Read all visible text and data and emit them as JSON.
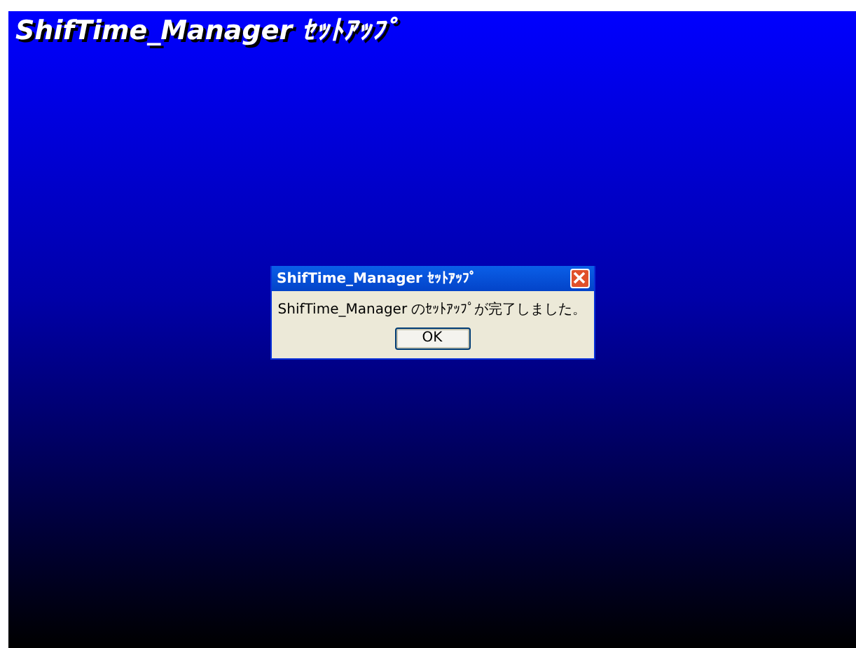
{
  "title": "ShifTime_Manager ｾｯﾄｱｯﾌﾟ",
  "dialog": {
    "title": "ShifTime_Manager ｾｯﾄｱｯﾌﾟ",
    "message": "ShifTime_Manager のｾｯﾄｱｯﾌﾟが完了しました。",
    "buttons": [
      {
        "label": "OK"
      }
    ]
  }
}
